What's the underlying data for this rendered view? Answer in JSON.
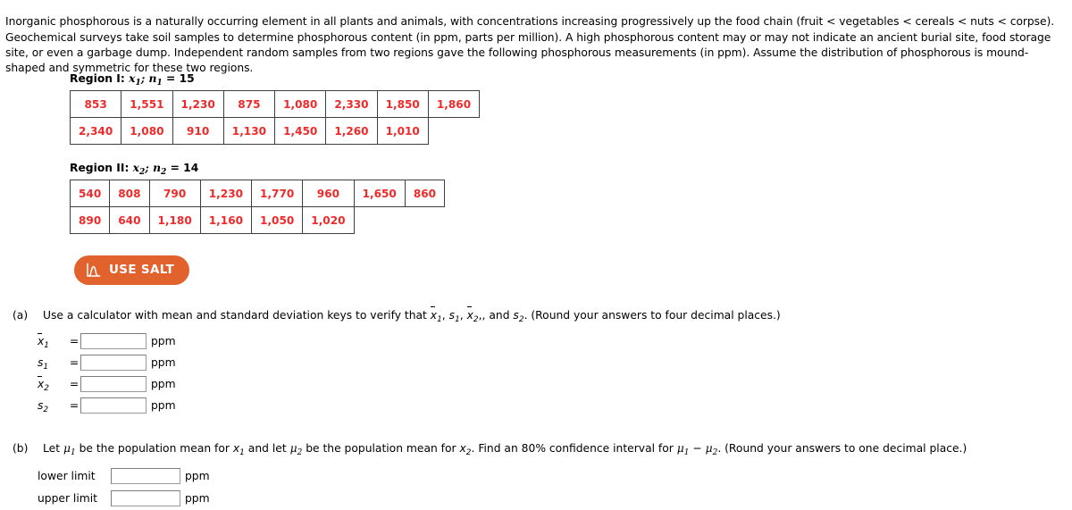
{
  "intro": {
    "paragraph": "Inorganic phosphorous is a naturally occurring element in all plants and animals, with concentrations increasing progressively up the food chain (fruit < vegetables < cereals < nuts < corpse). Geochemical surveys take soil samples to determine phosphorous content (in ppm, parts per million). A high phosphorous content may or may not indicate an ancient burial site, food storage site, or even a garbage dump. Independent random samples from two regions gave the following phosphorous measurements (in ppm). Assume the distribution of phosphorous is mound-shaped and symmetric for these two regions."
  },
  "region1": {
    "caption_prefix": "Region I:",
    "caption_var": "x",
    "caption_var_sub": "1",
    "caption_sep": ";",
    "caption_n": "n",
    "caption_n_sub": "1",
    "caption_eq": "= 15",
    "rows": [
      [
        "853",
        "1,551",
        "1,230",
        "875",
        "1,080",
        "2,330",
        "1,850",
        "1,860"
      ],
      [
        "2,340",
        "1,080",
        "910",
        "1,130",
        "1,450",
        "1,260",
        "1,010"
      ]
    ]
  },
  "region2": {
    "caption_prefix": "Region II:",
    "caption_var": "x",
    "caption_var_sub": "2",
    "caption_sep": ";",
    "caption_n": "n",
    "caption_n_sub": "2",
    "caption_eq": "= 14",
    "rows": [
      [
        "540",
        "808",
        "790",
        "1,230",
        "1,770",
        "960",
        "1,650",
        "860"
      ],
      [
        "890",
        "640",
        "1,180",
        "1,160",
        "1,050",
        "1,020"
      ]
    ]
  },
  "salt_button": {
    "label": "USE SALT",
    "icon": "normal-curve-icon",
    "background": "#e2622e",
    "text_color": "#ffffff"
  },
  "part_a": {
    "label": "(a)",
    "prompt_start": "Use a calculator with mean and standard deviation keys to verify that ",
    "prompt_end": ". (Round your answers to four decimal places.)",
    "conjunction": ", and ",
    "answers": [
      {
        "name": "x̄₁",
        "eq": "=",
        "value": "",
        "unit": "ppm"
      },
      {
        "name": "s₁",
        "eq": "=",
        "value": "",
        "unit": "ppm"
      },
      {
        "name": "x̄₂",
        "eq": "=",
        "value": "",
        "unit": "ppm"
      },
      {
        "name": "s₂",
        "eq": "=",
        "value": "",
        "unit": "ppm"
      }
    ]
  },
  "part_b": {
    "label": "(b)",
    "prompt_1": "Let ",
    "prompt_2": " be the population mean for ",
    "prompt_3": " and let ",
    "prompt_4": " be the population mean for ",
    "prompt_5": ". Find an 80% confidence interval for ",
    "prompt_6": ". (Round your answers to one decimal place.)",
    "answers": [
      {
        "name": "lower limit",
        "value": "",
        "unit": "ppm"
      },
      {
        "name": "upper limit",
        "value": "",
        "unit": "ppm"
      }
    ]
  },
  "colors": {
    "data_red": "#ee2a2a",
    "salt_orange": "#e2622e",
    "border_gray": "#3f3f3f"
  }
}
